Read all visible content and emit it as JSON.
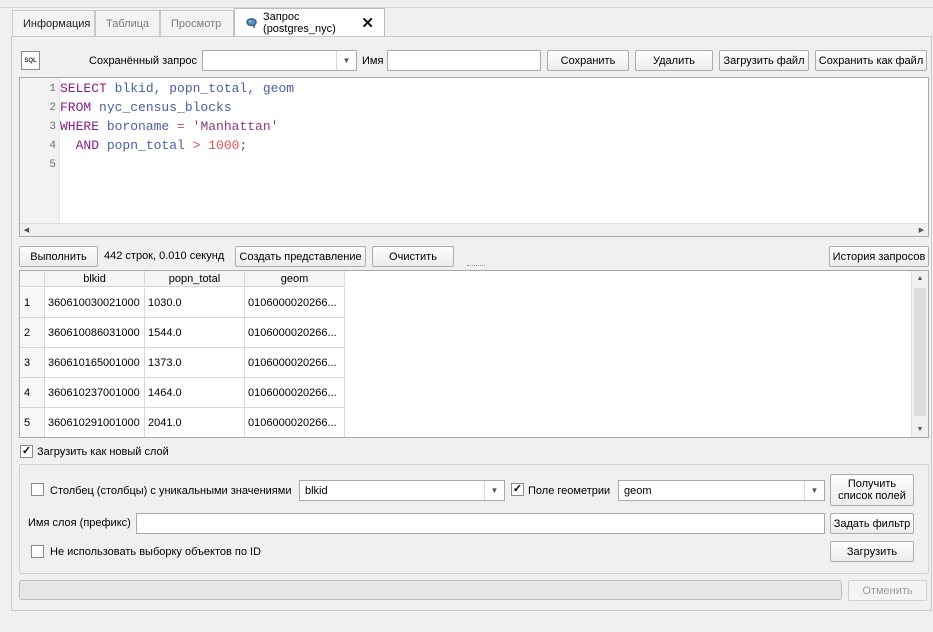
{
  "tabs": [
    {
      "label": "Информация"
    },
    {
      "label": "Таблица"
    },
    {
      "label": "Просмотр"
    },
    {
      "label": "Запрос (postgres_nyc)"
    }
  ],
  "toolbar": {
    "sql_icon_text": "SQL",
    "saved_query_label": "Сохранённый запрос",
    "saved_query_value": "",
    "name_label": "Имя",
    "name_value": "",
    "save": "Сохранить",
    "delete": "Удалить",
    "load_file": "Загрузить файл",
    "save_as_file": "Сохранить как файл"
  },
  "editor": {
    "lines": [
      {
        "num": "1",
        "tokens": [
          {
            "t": "SELECT",
            "c": "kw"
          },
          {
            "t": " blkid, popn_total, geom",
            "c": "id"
          }
        ]
      },
      {
        "num": "2",
        "tokens": [
          {
            "t": "FROM",
            "c": "kw"
          },
          {
            "t": " nyc_census_blocks",
            "c": "id"
          }
        ]
      },
      {
        "num": "3",
        "tokens": [
          {
            "t": "WHERE",
            "c": "kw"
          },
          {
            "t": " boroname ",
            "c": "id"
          },
          {
            "t": "=",
            "c": "op"
          },
          {
            "t": " 'Manhattan'",
            "c": "str"
          }
        ]
      },
      {
        "num": "4",
        "tokens": [
          {
            "t": "  AND",
            "c": "kw"
          },
          {
            "t": " popn_total ",
            "c": "id"
          },
          {
            "t": ">",
            "c": "op"
          },
          {
            "t": " 1000",
            "c": "num"
          },
          {
            "t": ";",
            "c": "id"
          }
        ]
      },
      {
        "num": "5",
        "tokens": []
      }
    ]
  },
  "actions": {
    "execute": "Выполнить",
    "status": "442 строк, 0.010 секунд",
    "create_view": "Создать представление",
    "clear": "Очистить",
    "history": "История запросов"
  },
  "results": {
    "columns": [
      "blkid",
      "popn_total",
      "geom"
    ],
    "rows": [
      {
        "n": "1",
        "cells": [
          "360610030021000",
          "1030.0",
          "0106000020266..."
        ]
      },
      {
        "n": "2",
        "cells": [
          "360610086031000",
          "1544.0",
          "0106000020266..."
        ]
      },
      {
        "n": "3",
        "cells": [
          "360610165001000",
          "1373.0",
          "0106000020266..."
        ]
      },
      {
        "n": "4",
        "cells": [
          "360610237001000",
          "1464.0",
          "0106000020266..."
        ]
      },
      {
        "n": "5",
        "cells": [
          "360610291001000",
          "2041.0",
          "0106000020266..."
        ]
      }
    ]
  },
  "layer": {
    "load_as_layer_label": "Загрузить как новый слой",
    "load_as_layer_checked": true,
    "unique_cols_label": "Столбец (столбцы) с уникальными значениями",
    "unique_cols_checked": false,
    "unique_cols_value": "blkid",
    "geom_field_label": "Поле геометрии",
    "geom_field_checked": true,
    "geom_field_value": "geom",
    "get_fields_line1": "Получить",
    "get_fields_line2": "список полей",
    "layer_name_label": "Имя слоя (префикс)",
    "layer_name_value": "",
    "set_filter": "Задать фильтр",
    "no_select_by_id_label": "Не использовать выборку объектов по ID",
    "no_select_by_id_checked": false,
    "load": "Загрузить"
  },
  "footer": {
    "cancel": "Отменить"
  }
}
